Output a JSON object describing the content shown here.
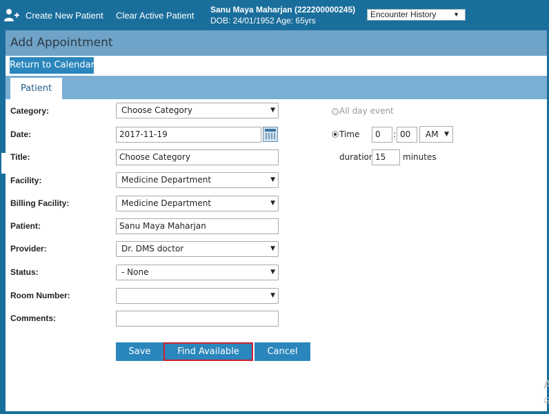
{
  "header": {
    "create_new_patient": "Create New Patient",
    "clear_active_patient": "Clear Active Patient",
    "patient_name_id": "Sanu Maya Maharjan (222200000245)",
    "dob_age": "DOB: 24/01/1952 Age: 65yrs",
    "encounter_select": "Encounter History"
  },
  "page": {
    "title": "Add Appointment",
    "return_button": "Return to Calendar",
    "tab_patient": "Patient"
  },
  "form": {
    "category_label": "Category:",
    "category_value": "Choose Category",
    "date_label": "Date:",
    "date_value": "2017-11-19",
    "title_label": "Title:",
    "title_value": "Choose Category",
    "facility_label": "Facility:",
    "facility_value": "Medicine Department",
    "billing_facility_label": "Billing Facility:",
    "billing_facility_value": "Medicine Department",
    "patient_label": "Patient:",
    "patient_value": "Sanu Maya Maharjan",
    "provider_label": "Provider:",
    "provider_value": "Dr. DMS doctor",
    "status_label": "Status:",
    "status_value": "- None",
    "room_number_label": "Room Number:",
    "room_number_value": "",
    "comments_label": "Comments:",
    "comments_value": ""
  },
  "time": {
    "all_day_label": "All day event",
    "time_label": "Time",
    "hour": "0",
    "minute": "00",
    "ampm": "AM",
    "duration_label": "duration",
    "duration_value": "15",
    "minutes_label": "minutes"
  },
  "buttons": {
    "save": "Save",
    "find_available": "Find Available",
    "cancel": "Cancel"
  },
  "colors": {
    "header_blue": "#1a6e9c",
    "button_blue": "#2a86bc",
    "highlight_red": "#d0202e"
  },
  "watermark": {
    "line1": "A",
    "line2": "G"
  }
}
